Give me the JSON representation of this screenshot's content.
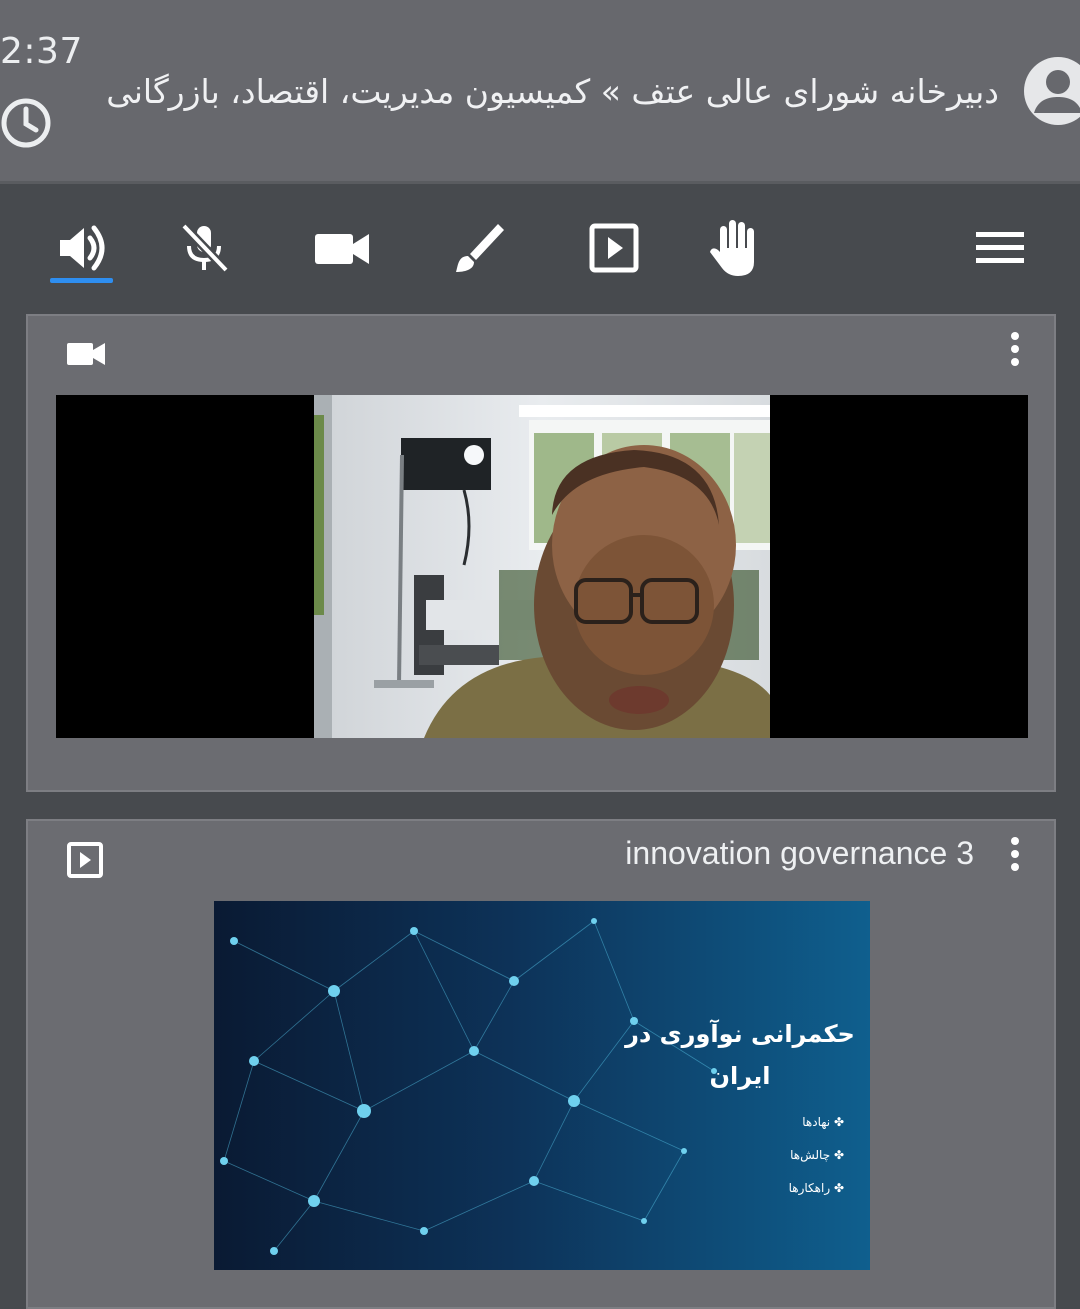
{
  "header": {
    "elapsed_time": "2:37",
    "room_title": "دبیرخانه شورای عالی عتف » کمیسیون مدیریت، اقتصاد، بازرگانی"
  },
  "toolbar": {
    "buttons": [
      {
        "name": "speaker",
        "active": true
      },
      {
        "name": "microphone-muted"
      },
      {
        "name": "camera"
      },
      {
        "name": "whiteboard-brush"
      },
      {
        "name": "presentation"
      },
      {
        "name": "raise-hand"
      },
      {
        "name": "menu"
      }
    ],
    "accent_color": "#2e8ef0"
  },
  "video_panel": {
    "icon": "videocam-icon",
    "menu_icon": "kebab-icon"
  },
  "presentation_panel": {
    "icon": "play-box-icon",
    "title": "innovation governance 3",
    "menu_icon": "kebab-icon",
    "slide": {
      "title": "حکمرانی نوآوری در ایران",
      "bullets": [
        "نهادها",
        "چالش‌ها",
        "راهکارها"
      ]
    }
  },
  "colors": {
    "header_bg": "#67686d",
    "app_bg": "#474a4e",
    "panel_bg": "#6b6c71"
  }
}
